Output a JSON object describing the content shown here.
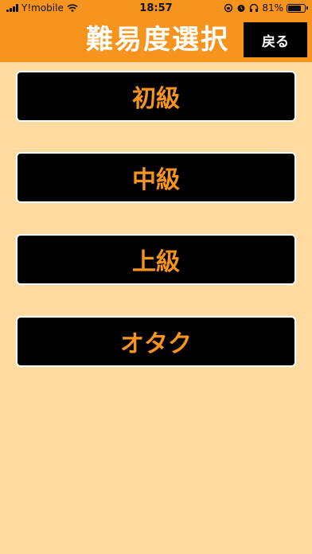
{
  "status_bar": {
    "carrier": "Y!mobile",
    "time": "18:57",
    "battery_percent": "81%",
    "battery_level": 0.81,
    "icons": [
      "signal-icon",
      "wifi-icon",
      "orientation-lock-icon",
      "alarm-icon",
      "headphones-icon",
      "battery-icon"
    ]
  },
  "header": {
    "title": "難易度選択",
    "back_label": "戻る"
  },
  "levels": [
    {
      "label": "初級"
    },
    {
      "label": "中級"
    },
    {
      "label": "上級"
    },
    {
      "label": "オタク"
    }
  ],
  "colors": {
    "accent": "#F7941D",
    "background": "#FFDBA2",
    "button_bg": "#000000",
    "button_text": "#F7941D"
  }
}
